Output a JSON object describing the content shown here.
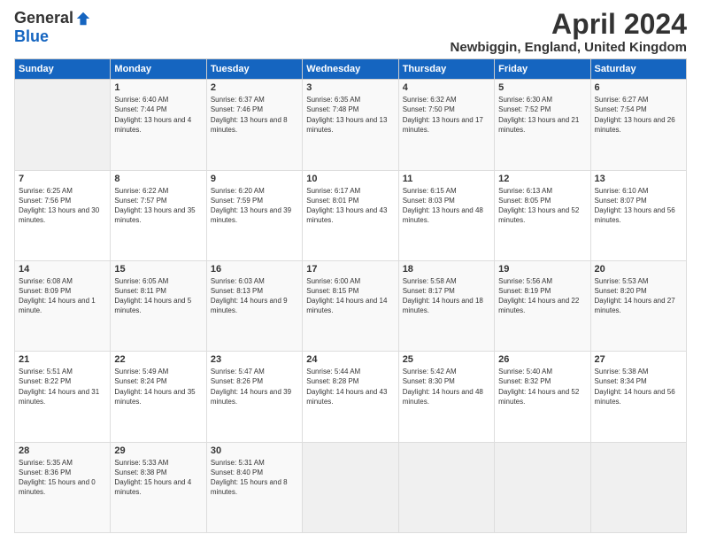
{
  "header": {
    "logo_general": "General",
    "logo_blue": "Blue",
    "month_title": "April 2024",
    "location": "Newbiggin, England, United Kingdom"
  },
  "days_of_week": [
    "Sunday",
    "Monday",
    "Tuesday",
    "Wednesday",
    "Thursday",
    "Friday",
    "Saturday"
  ],
  "weeks": [
    [
      {
        "day": "",
        "sunrise": "",
        "sunset": "",
        "daylight": ""
      },
      {
        "day": "1",
        "sunrise": "Sunrise: 6:40 AM",
        "sunset": "Sunset: 7:44 PM",
        "daylight": "Daylight: 13 hours and 4 minutes."
      },
      {
        "day": "2",
        "sunrise": "Sunrise: 6:37 AM",
        "sunset": "Sunset: 7:46 PM",
        "daylight": "Daylight: 13 hours and 8 minutes."
      },
      {
        "day": "3",
        "sunrise": "Sunrise: 6:35 AM",
        "sunset": "Sunset: 7:48 PM",
        "daylight": "Daylight: 13 hours and 13 minutes."
      },
      {
        "day": "4",
        "sunrise": "Sunrise: 6:32 AM",
        "sunset": "Sunset: 7:50 PM",
        "daylight": "Daylight: 13 hours and 17 minutes."
      },
      {
        "day": "5",
        "sunrise": "Sunrise: 6:30 AM",
        "sunset": "Sunset: 7:52 PM",
        "daylight": "Daylight: 13 hours and 21 minutes."
      },
      {
        "day": "6",
        "sunrise": "Sunrise: 6:27 AM",
        "sunset": "Sunset: 7:54 PM",
        "daylight": "Daylight: 13 hours and 26 minutes."
      }
    ],
    [
      {
        "day": "7",
        "sunrise": "Sunrise: 6:25 AM",
        "sunset": "Sunset: 7:56 PM",
        "daylight": "Daylight: 13 hours and 30 minutes."
      },
      {
        "day": "8",
        "sunrise": "Sunrise: 6:22 AM",
        "sunset": "Sunset: 7:57 PM",
        "daylight": "Daylight: 13 hours and 35 minutes."
      },
      {
        "day": "9",
        "sunrise": "Sunrise: 6:20 AM",
        "sunset": "Sunset: 7:59 PM",
        "daylight": "Daylight: 13 hours and 39 minutes."
      },
      {
        "day": "10",
        "sunrise": "Sunrise: 6:17 AM",
        "sunset": "Sunset: 8:01 PM",
        "daylight": "Daylight: 13 hours and 43 minutes."
      },
      {
        "day": "11",
        "sunrise": "Sunrise: 6:15 AM",
        "sunset": "Sunset: 8:03 PM",
        "daylight": "Daylight: 13 hours and 48 minutes."
      },
      {
        "day": "12",
        "sunrise": "Sunrise: 6:13 AM",
        "sunset": "Sunset: 8:05 PM",
        "daylight": "Daylight: 13 hours and 52 minutes."
      },
      {
        "day": "13",
        "sunrise": "Sunrise: 6:10 AM",
        "sunset": "Sunset: 8:07 PM",
        "daylight": "Daylight: 13 hours and 56 minutes."
      }
    ],
    [
      {
        "day": "14",
        "sunrise": "Sunrise: 6:08 AM",
        "sunset": "Sunset: 8:09 PM",
        "daylight": "Daylight: 14 hours and 1 minute."
      },
      {
        "day": "15",
        "sunrise": "Sunrise: 6:05 AM",
        "sunset": "Sunset: 8:11 PM",
        "daylight": "Daylight: 14 hours and 5 minutes."
      },
      {
        "day": "16",
        "sunrise": "Sunrise: 6:03 AM",
        "sunset": "Sunset: 8:13 PM",
        "daylight": "Daylight: 14 hours and 9 minutes."
      },
      {
        "day": "17",
        "sunrise": "Sunrise: 6:00 AM",
        "sunset": "Sunset: 8:15 PM",
        "daylight": "Daylight: 14 hours and 14 minutes."
      },
      {
        "day": "18",
        "sunrise": "Sunrise: 5:58 AM",
        "sunset": "Sunset: 8:17 PM",
        "daylight": "Daylight: 14 hours and 18 minutes."
      },
      {
        "day": "19",
        "sunrise": "Sunrise: 5:56 AM",
        "sunset": "Sunset: 8:19 PM",
        "daylight": "Daylight: 14 hours and 22 minutes."
      },
      {
        "day": "20",
        "sunrise": "Sunrise: 5:53 AM",
        "sunset": "Sunset: 8:20 PM",
        "daylight": "Daylight: 14 hours and 27 minutes."
      }
    ],
    [
      {
        "day": "21",
        "sunrise": "Sunrise: 5:51 AM",
        "sunset": "Sunset: 8:22 PM",
        "daylight": "Daylight: 14 hours and 31 minutes."
      },
      {
        "day": "22",
        "sunrise": "Sunrise: 5:49 AM",
        "sunset": "Sunset: 8:24 PM",
        "daylight": "Daylight: 14 hours and 35 minutes."
      },
      {
        "day": "23",
        "sunrise": "Sunrise: 5:47 AM",
        "sunset": "Sunset: 8:26 PM",
        "daylight": "Daylight: 14 hours and 39 minutes."
      },
      {
        "day": "24",
        "sunrise": "Sunrise: 5:44 AM",
        "sunset": "Sunset: 8:28 PM",
        "daylight": "Daylight: 14 hours and 43 minutes."
      },
      {
        "day": "25",
        "sunrise": "Sunrise: 5:42 AM",
        "sunset": "Sunset: 8:30 PM",
        "daylight": "Daylight: 14 hours and 48 minutes."
      },
      {
        "day": "26",
        "sunrise": "Sunrise: 5:40 AM",
        "sunset": "Sunset: 8:32 PM",
        "daylight": "Daylight: 14 hours and 52 minutes."
      },
      {
        "day": "27",
        "sunrise": "Sunrise: 5:38 AM",
        "sunset": "Sunset: 8:34 PM",
        "daylight": "Daylight: 14 hours and 56 minutes."
      }
    ],
    [
      {
        "day": "28",
        "sunrise": "Sunrise: 5:35 AM",
        "sunset": "Sunset: 8:36 PM",
        "daylight": "Daylight: 15 hours and 0 minutes."
      },
      {
        "day": "29",
        "sunrise": "Sunrise: 5:33 AM",
        "sunset": "Sunset: 8:38 PM",
        "daylight": "Daylight: 15 hours and 4 minutes."
      },
      {
        "day": "30",
        "sunrise": "Sunrise: 5:31 AM",
        "sunset": "Sunset: 8:40 PM",
        "daylight": "Daylight: 15 hours and 8 minutes."
      },
      {
        "day": "",
        "sunrise": "",
        "sunset": "",
        "daylight": ""
      },
      {
        "day": "",
        "sunrise": "",
        "sunset": "",
        "daylight": ""
      },
      {
        "day": "",
        "sunrise": "",
        "sunset": "",
        "daylight": ""
      },
      {
        "day": "",
        "sunrise": "",
        "sunset": "",
        "daylight": ""
      }
    ]
  ]
}
